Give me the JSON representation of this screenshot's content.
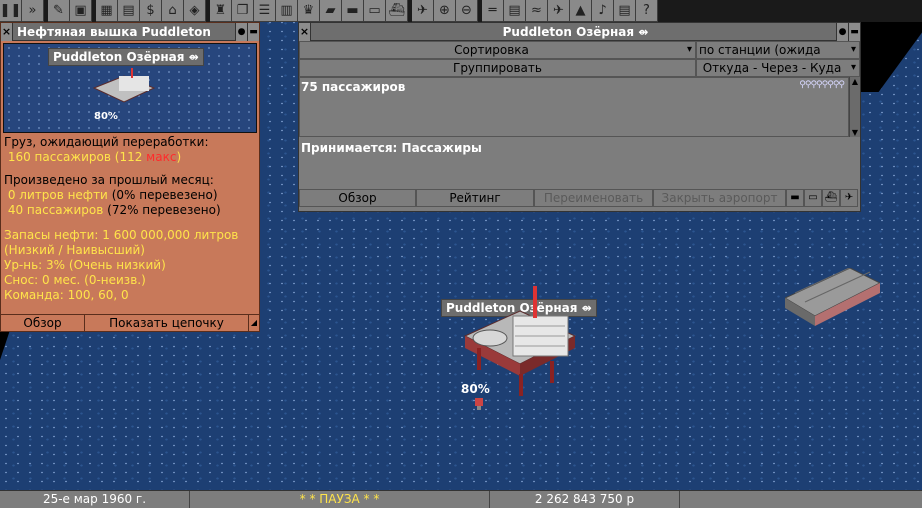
{
  "toolbar": {
    "icons": [
      "pause-icon",
      "fast-forward-icon",
      "settings-wrench-icon",
      "save-icon",
      "minimap-icon",
      "town-list-icon",
      "subsidies-icon",
      "station-list-icon",
      "finances-icon",
      "company-icon",
      "story-book-icon",
      "goal-list-icon",
      "graphs-icon",
      "league-table-icon",
      "industries-icon",
      "train-list-icon",
      "road-vehicle-list-icon",
      "ship-list-icon",
      "aircraft-list-icon",
      "zoom-in-icon",
      "zoom-out-icon",
      "build-rail-icon",
      "build-road-icon",
      "build-water-icon",
      "build-air-icon",
      "landscaping-icon",
      "music-icon",
      "messages-icon",
      "help-icon"
    ],
    "glyphs": [
      "❚❚",
      "»",
      "✎",
      "▣",
      "▦",
      "▤",
      "$",
      "⌂",
      "◈",
      "♜",
      "❐",
      "☰",
      "▥",
      "♛",
      "▰",
      "▬",
      "▭",
      "⛴",
      "✈",
      "⊕",
      "⊖",
      "═",
      "▤",
      "≈",
      "✈",
      "▲",
      "♪",
      "▤",
      "?"
    ]
  },
  "industry_window": {
    "title": "Нефтяная вышка Puddleton",
    "sign": "Puddleton Озёрная",
    "rating": "80%",
    "cargo_waiting_label": "Груз, ожидающий переработки:",
    "waiting_amount": "160 пассажиров",
    "waiting_max_prefix": "(112 ",
    "waiting_max_word": "макс",
    "waiting_max_suffix": ")",
    "produced_label": "Произведено за прошлый месяц:",
    "prod1_value": "0 литров нефти",
    "prod1_pct": "(0% перевезено)",
    "prod2_value": "40 пассажиров",
    "prod2_pct": "(72% перевезено)",
    "reserves": "Запасы нефти: 1 600 000,000 литров",
    "reserves_range": "(Низкий / Наивысший)",
    "level": "Ур-нь: 3% (Очень низкий)",
    "demolish": "Снос: 0 мес. (0-неизв.)",
    "command": "Команда: 100, 60, 0",
    "btn_overview": "Обзор",
    "btn_chain": "Показать цепочку"
  },
  "station_window": {
    "title": "Puddleton Озёрная",
    "sort_label": "Сортировка",
    "sort_value": "по станции (ожида",
    "group_label": "Группировать",
    "group_value": "Откуда - Через - Куда",
    "waiting": "75 пассажиров",
    "waiting_icons": "⚲⚲⚲⚲⚲⚲⚲⚲",
    "accepts": "Принимается: Пассажиры",
    "btn_overview": "Обзор",
    "btn_rating": "Рейтинг",
    "btn_rename": "Переименовать",
    "btn_close_airport": "Закрыть аэропорт"
  },
  "map": {
    "station_sign": "Puddleton Озёрная",
    "rating": "80%"
  },
  "status": {
    "date": "25-е мар 1960 г.",
    "pause": "* *  ПАУЗА  * *",
    "money": "2 262 843 750 р"
  }
}
